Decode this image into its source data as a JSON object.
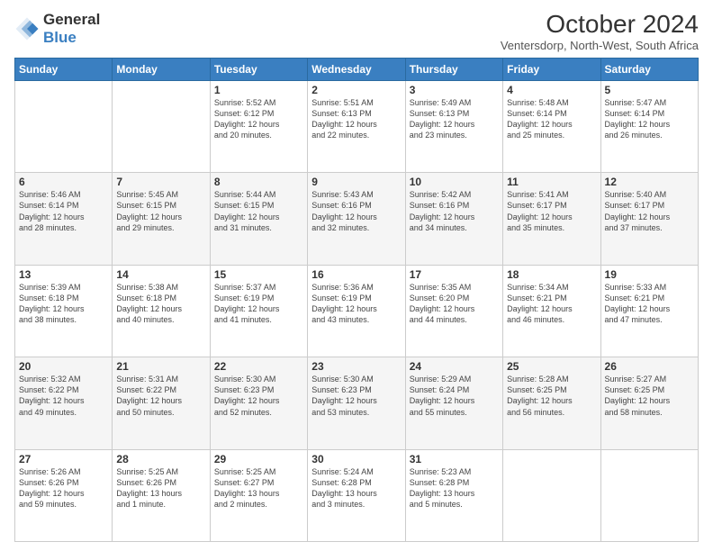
{
  "logo": {
    "line1": "General",
    "line2": "Blue"
  },
  "title": "October 2024",
  "subtitle": "Ventersdorp, North-West, South Africa",
  "days_of_week": [
    "Sunday",
    "Monday",
    "Tuesday",
    "Wednesday",
    "Thursday",
    "Friday",
    "Saturday"
  ],
  "weeks": [
    [
      {
        "day": "",
        "info": ""
      },
      {
        "day": "",
        "info": ""
      },
      {
        "day": "1",
        "info": "Sunrise: 5:52 AM\nSunset: 6:12 PM\nDaylight: 12 hours\nand 20 minutes."
      },
      {
        "day": "2",
        "info": "Sunrise: 5:51 AM\nSunset: 6:13 PM\nDaylight: 12 hours\nand 22 minutes."
      },
      {
        "day": "3",
        "info": "Sunrise: 5:49 AM\nSunset: 6:13 PM\nDaylight: 12 hours\nand 23 minutes."
      },
      {
        "day": "4",
        "info": "Sunrise: 5:48 AM\nSunset: 6:14 PM\nDaylight: 12 hours\nand 25 minutes."
      },
      {
        "day": "5",
        "info": "Sunrise: 5:47 AM\nSunset: 6:14 PM\nDaylight: 12 hours\nand 26 minutes."
      }
    ],
    [
      {
        "day": "6",
        "info": "Sunrise: 5:46 AM\nSunset: 6:14 PM\nDaylight: 12 hours\nand 28 minutes."
      },
      {
        "day": "7",
        "info": "Sunrise: 5:45 AM\nSunset: 6:15 PM\nDaylight: 12 hours\nand 29 minutes."
      },
      {
        "day": "8",
        "info": "Sunrise: 5:44 AM\nSunset: 6:15 PM\nDaylight: 12 hours\nand 31 minutes."
      },
      {
        "day": "9",
        "info": "Sunrise: 5:43 AM\nSunset: 6:16 PM\nDaylight: 12 hours\nand 32 minutes."
      },
      {
        "day": "10",
        "info": "Sunrise: 5:42 AM\nSunset: 6:16 PM\nDaylight: 12 hours\nand 34 minutes."
      },
      {
        "day": "11",
        "info": "Sunrise: 5:41 AM\nSunset: 6:17 PM\nDaylight: 12 hours\nand 35 minutes."
      },
      {
        "day": "12",
        "info": "Sunrise: 5:40 AM\nSunset: 6:17 PM\nDaylight: 12 hours\nand 37 minutes."
      }
    ],
    [
      {
        "day": "13",
        "info": "Sunrise: 5:39 AM\nSunset: 6:18 PM\nDaylight: 12 hours\nand 38 minutes."
      },
      {
        "day": "14",
        "info": "Sunrise: 5:38 AM\nSunset: 6:18 PM\nDaylight: 12 hours\nand 40 minutes."
      },
      {
        "day": "15",
        "info": "Sunrise: 5:37 AM\nSunset: 6:19 PM\nDaylight: 12 hours\nand 41 minutes."
      },
      {
        "day": "16",
        "info": "Sunrise: 5:36 AM\nSunset: 6:19 PM\nDaylight: 12 hours\nand 43 minutes."
      },
      {
        "day": "17",
        "info": "Sunrise: 5:35 AM\nSunset: 6:20 PM\nDaylight: 12 hours\nand 44 minutes."
      },
      {
        "day": "18",
        "info": "Sunrise: 5:34 AM\nSunset: 6:21 PM\nDaylight: 12 hours\nand 46 minutes."
      },
      {
        "day": "19",
        "info": "Sunrise: 5:33 AM\nSunset: 6:21 PM\nDaylight: 12 hours\nand 47 minutes."
      }
    ],
    [
      {
        "day": "20",
        "info": "Sunrise: 5:32 AM\nSunset: 6:22 PM\nDaylight: 12 hours\nand 49 minutes."
      },
      {
        "day": "21",
        "info": "Sunrise: 5:31 AM\nSunset: 6:22 PM\nDaylight: 12 hours\nand 50 minutes."
      },
      {
        "day": "22",
        "info": "Sunrise: 5:30 AM\nSunset: 6:23 PM\nDaylight: 12 hours\nand 52 minutes."
      },
      {
        "day": "23",
        "info": "Sunrise: 5:30 AM\nSunset: 6:23 PM\nDaylight: 12 hours\nand 53 minutes."
      },
      {
        "day": "24",
        "info": "Sunrise: 5:29 AM\nSunset: 6:24 PM\nDaylight: 12 hours\nand 55 minutes."
      },
      {
        "day": "25",
        "info": "Sunrise: 5:28 AM\nSunset: 6:25 PM\nDaylight: 12 hours\nand 56 minutes."
      },
      {
        "day": "26",
        "info": "Sunrise: 5:27 AM\nSunset: 6:25 PM\nDaylight: 12 hours\nand 58 minutes."
      }
    ],
    [
      {
        "day": "27",
        "info": "Sunrise: 5:26 AM\nSunset: 6:26 PM\nDaylight: 12 hours\nand 59 minutes."
      },
      {
        "day": "28",
        "info": "Sunrise: 5:25 AM\nSunset: 6:26 PM\nDaylight: 13 hours\nand 1 minute."
      },
      {
        "day": "29",
        "info": "Sunrise: 5:25 AM\nSunset: 6:27 PM\nDaylight: 13 hours\nand 2 minutes."
      },
      {
        "day": "30",
        "info": "Sunrise: 5:24 AM\nSunset: 6:28 PM\nDaylight: 13 hours\nand 3 minutes."
      },
      {
        "day": "31",
        "info": "Sunrise: 5:23 AM\nSunset: 6:28 PM\nDaylight: 13 hours\nand 5 minutes."
      },
      {
        "day": "",
        "info": ""
      },
      {
        "day": "",
        "info": ""
      }
    ]
  ]
}
